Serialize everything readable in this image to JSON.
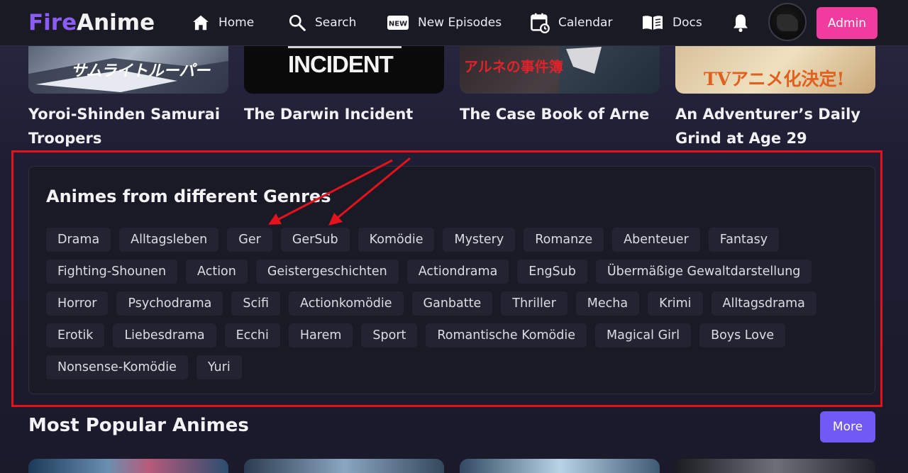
{
  "app": {
    "logo_part1": "Fire",
    "logo_part2": "Anime"
  },
  "nav": {
    "items": [
      {
        "label": "Home",
        "icon": "home-icon"
      },
      {
        "label": "Search",
        "icon": "search-icon"
      },
      {
        "label": "New Episodes",
        "icon": "new-badge-icon",
        "badge": "NEW"
      },
      {
        "label": "Calendar",
        "icon": "calendar-icon"
      },
      {
        "label": "Docs",
        "icon": "book-icon"
      }
    ],
    "notification_icon": "bell-icon",
    "admin_label": "Admin"
  },
  "top_cards": [
    {
      "title": "Yoroi-Shinden Samurai Troopers",
      "thumb_text": "サムライトルーパー"
    },
    {
      "title": "The Darwin Incident",
      "thumb_text": "INCIDENT"
    },
    {
      "title": "The Case Book of Arne",
      "thumb_text": "アルネの事件簿"
    },
    {
      "title": "An Adventurer’s Daily Grind at Age 29",
      "thumb_text": "TVアニメ化決定!"
    }
  ],
  "genres": {
    "title": "Animes from different Genres",
    "items": [
      "Drama",
      "Alltagsleben",
      "Ger",
      "GerSub",
      "Komödie",
      "Mystery",
      "Romanze",
      "Abenteuer",
      "Fantasy",
      "Fighting-Shounen",
      "Action",
      "Geistergeschichten",
      "Actiondrama",
      "EngSub",
      "Übermäßige Gewaltdarstellung",
      "Horror",
      "Psychodrama",
      "Scifi",
      "Actionkomödie",
      "Ganbatte",
      "Thriller",
      "Mecha",
      "Krimi",
      "Alltagsdrama",
      "Erotik",
      "Liebesdrama",
      "Ecchi",
      "Harem",
      "Sport",
      "Romantische Komödie",
      "Magical Girl",
      "Boys Love",
      "Nonsense-Komödie",
      "Yuri"
    ]
  },
  "popular": {
    "title": "Most Popular Animes",
    "more_label": "More"
  },
  "colors": {
    "accent_purple": "#8b5cf6",
    "admin_pink": "#f03c9e",
    "more_button": "#7159f5",
    "annotation_red": "#e3121c"
  }
}
